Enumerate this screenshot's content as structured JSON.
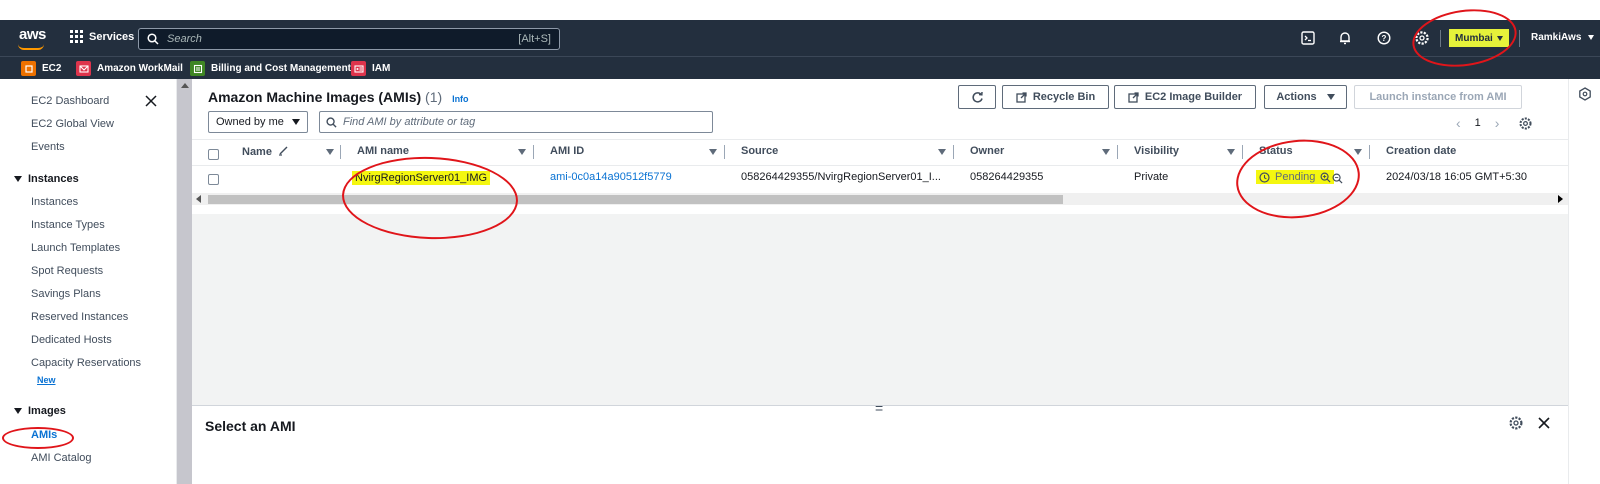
{
  "nav": {
    "logo": "aws",
    "services": "Services",
    "search_placeholder": "Search",
    "search_shortcut": "[Alt+S]",
    "region": "Mumbai",
    "user": "RamkiAws",
    "favorites": [
      {
        "label": "EC2",
        "icon": "ec2-icon",
        "color": "#ed7100"
      },
      {
        "label": "Amazon WorkMail",
        "icon": "workmail-icon",
        "color": "#dd344c"
      },
      {
        "label": "Billing and Cost Management",
        "icon": "billing-icon",
        "color": "#3f8624"
      },
      {
        "label": "IAM",
        "icon": "iam-icon",
        "color": "#dd344c"
      }
    ]
  },
  "sidebar": {
    "items_top": [
      "EC2 Dashboard",
      "EC2 Global View",
      "Events"
    ],
    "instances_header": "Instances",
    "instances": [
      "Instances",
      "Instance Types",
      "Launch Templates",
      "Spot Requests",
      "Savings Plans",
      "Reserved Instances",
      "Dedicated Hosts",
      "Capacity Reservations"
    ],
    "new_badge": "New",
    "images_header": "Images",
    "images": [
      "AMIs",
      "AMI Catalog"
    ]
  },
  "main": {
    "title": "Amazon Machine Images (AMIs)",
    "count": "(1)",
    "info": "Info",
    "buttons": {
      "recycle_bin": "Recycle Bin",
      "image_builder": "EC2 Image Builder",
      "actions": "Actions",
      "launch": "Launch instance from AMI"
    },
    "filter_owned": "Owned by me",
    "find_placeholder": "Find AMI by attribute or tag",
    "page": "1",
    "columns": [
      "Name",
      "AMI name",
      "AMI ID",
      "Source",
      "Owner",
      "Visibility",
      "Status",
      "Creation date"
    ],
    "rows": [
      {
        "name": "",
        "ami_name": "NvirgRegionServer01_IMG",
        "ami_id": "ami-0c0a14a90512f5779",
        "source": "058264429355/NvirgRegionServer01_I...",
        "owner": "058264429355",
        "visibility": "Private",
        "status": "Pending",
        "creation_date": "2024/03/18 16:05 GMT+5:30"
      }
    ]
  },
  "bottom": {
    "title": "Select an AMI"
  },
  "colors": {
    "nav_bg": "#232f3e",
    "link": "#0972d3",
    "highlight": "#f4f710",
    "annotation_red": "#e0151a"
  }
}
